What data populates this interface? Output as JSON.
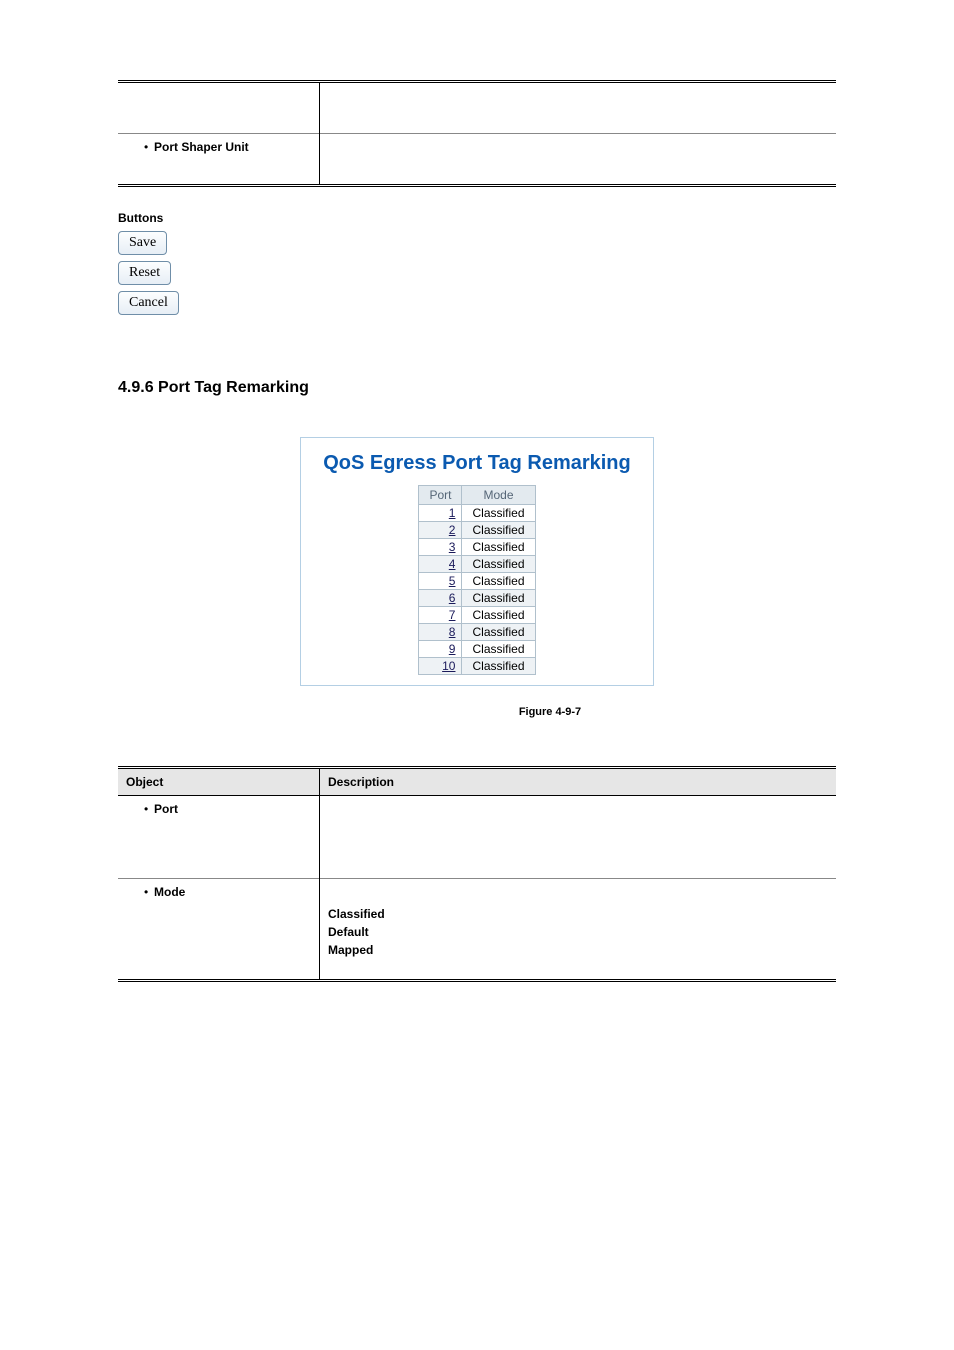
{
  "top_table": {
    "bullet": "Port Shaper Unit"
  },
  "buttons": {
    "heading": "Buttons",
    "save": "Save",
    "reset": "Reset",
    "cancel": "Cancel"
  },
  "section_heading": "4.9.6 Port Tag Remarking",
  "figure": {
    "title": "QoS Egress Port Tag Remarking",
    "col_port": "Port",
    "col_mode": "Mode",
    "rows": [
      {
        "port": "1",
        "mode": "Classified"
      },
      {
        "port": "2",
        "mode": "Classified"
      },
      {
        "port": "3",
        "mode": "Classified"
      },
      {
        "port": "4",
        "mode": "Classified"
      },
      {
        "port": "5",
        "mode": "Classified"
      },
      {
        "port": "6",
        "mode": "Classified"
      },
      {
        "port": "7",
        "mode": "Classified"
      },
      {
        "port": "8",
        "mode": "Classified"
      },
      {
        "port": "9",
        "mode": "Classified"
      },
      {
        "port": "10",
        "mode": "Classified"
      }
    ],
    "caption": "Figure 4-9-7"
  },
  "desc_table": {
    "head_object": "Object",
    "head_desc": "Description",
    "row_port": "Port",
    "row_mode": "Mode",
    "mode_vals": {
      "classified": "Classified",
      "default": "Default",
      "mapped": "Mapped"
    }
  }
}
